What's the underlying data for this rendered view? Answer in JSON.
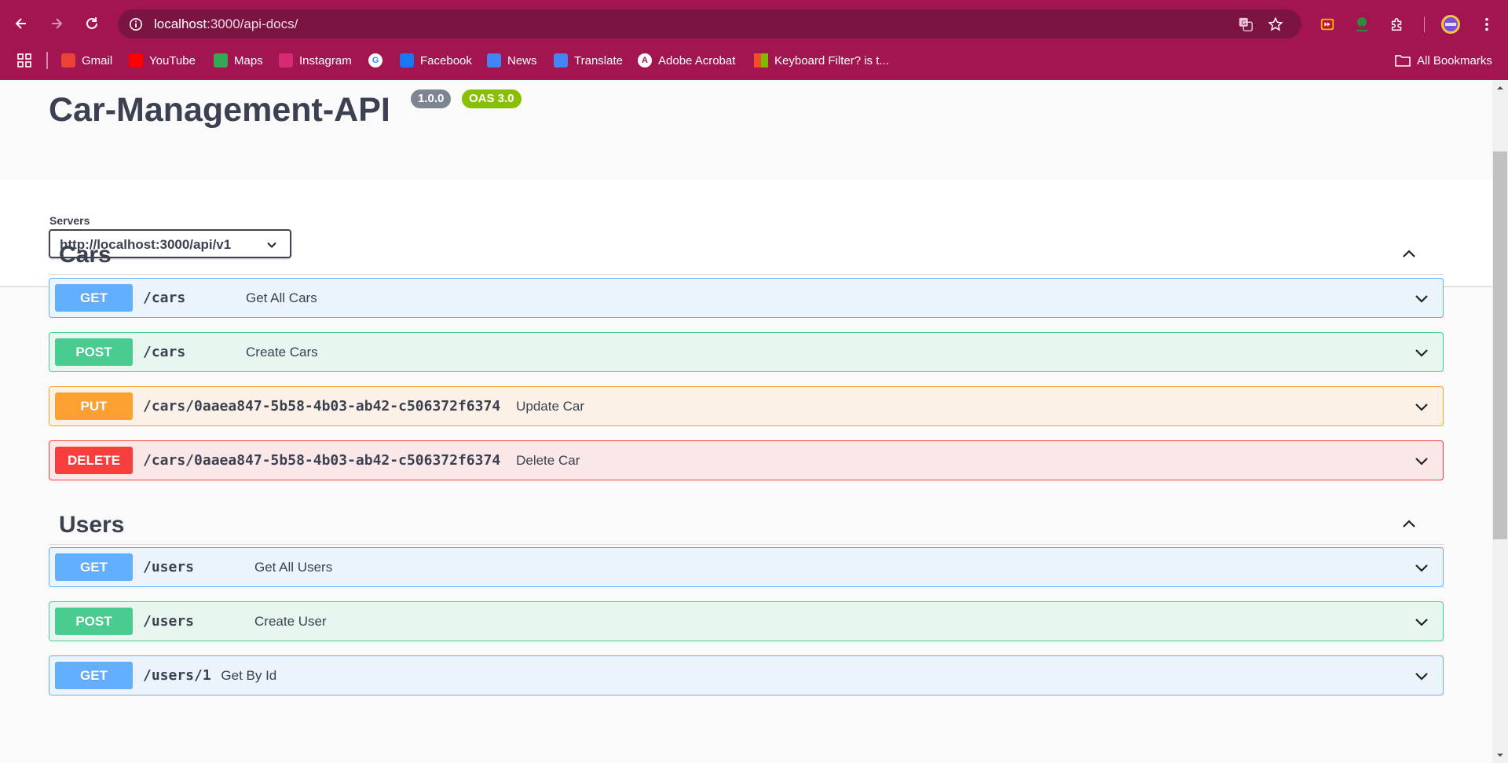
{
  "browser": {
    "url_host": "localhost",
    "url_rest": ":3000/api-docs/",
    "bookmarks": [
      {
        "label": "Gmail",
        "icon": "gmail-icon",
        "color": "#ea4335"
      },
      {
        "label": "YouTube",
        "icon": "youtube-icon",
        "color": "#ff0000"
      },
      {
        "label": "Maps",
        "icon": "maps-icon",
        "color": "#34a853"
      },
      {
        "label": "Instagram",
        "icon": "instagram-icon",
        "color": "#d62976"
      },
      {
        "label": "",
        "icon": "google-icon",
        "color": "#ffffff"
      },
      {
        "label": "Facebook",
        "icon": "facebook-icon",
        "color": "#1877f2"
      },
      {
        "label": "News",
        "icon": "news-icon",
        "color": "#4285f4"
      },
      {
        "label": "Translate",
        "icon": "translate-icon",
        "color": "#4285f4"
      },
      {
        "label": "Adobe Acrobat",
        "icon": "acrobat-icon",
        "color": "#ffffff"
      },
      {
        "label": "Keyboard Filter? is t...",
        "icon": "microsoft-icon",
        "color": "#f25022"
      }
    ],
    "all_bookmarks": "All Bookmarks"
  },
  "api": {
    "title": "Car-Management-API",
    "version": "1.0.0",
    "oas": "OAS 3.0"
  },
  "servers": {
    "label": "Servers",
    "selected": "http://localhost:3000/api/v1"
  },
  "tags": [
    {
      "name": "Cars",
      "operations": [
        {
          "method": "GET",
          "path": "/cars",
          "summary": "Get All Cars"
        },
        {
          "method": "POST",
          "path": "/cars",
          "summary": "Create Cars"
        },
        {
          "method": "PUT",
          "path": "/cars/0aaea847-5b58-4b03-ab42-c506372f6374",
          "summary": "Update Car"
        },
        {
          "method": "DELETE",
          "path": "/cars/0aaea847-5b58-4b03-ab42-c506372f6374",
          "summary": "Delete Car"
        }
      ]
    },
    {
      "name": "Users",
      "operations": [
        {
          "method": "GET",
          "path": "/users",
          "summary": "Get All Users"
        },
        {
          "method": "POST",
          "path": "/users",
          "summary": "Create User"
        },
        {
          "method": "GET",
          "path": "/users/1",
          "summary": "Get By Id"
        }
      ]
    }
  ],
  "colors": {
    "chrome": "#a31550",
    "omnibox": "#7c1442",
    "get": "#61affe",
    "post": "#49cc90",
    "put": "#fca130",
    "delete": "#f93e3e",
    "version_badge": "#7d8492",
    "oas_badge": "#89bf04"
  }
}
